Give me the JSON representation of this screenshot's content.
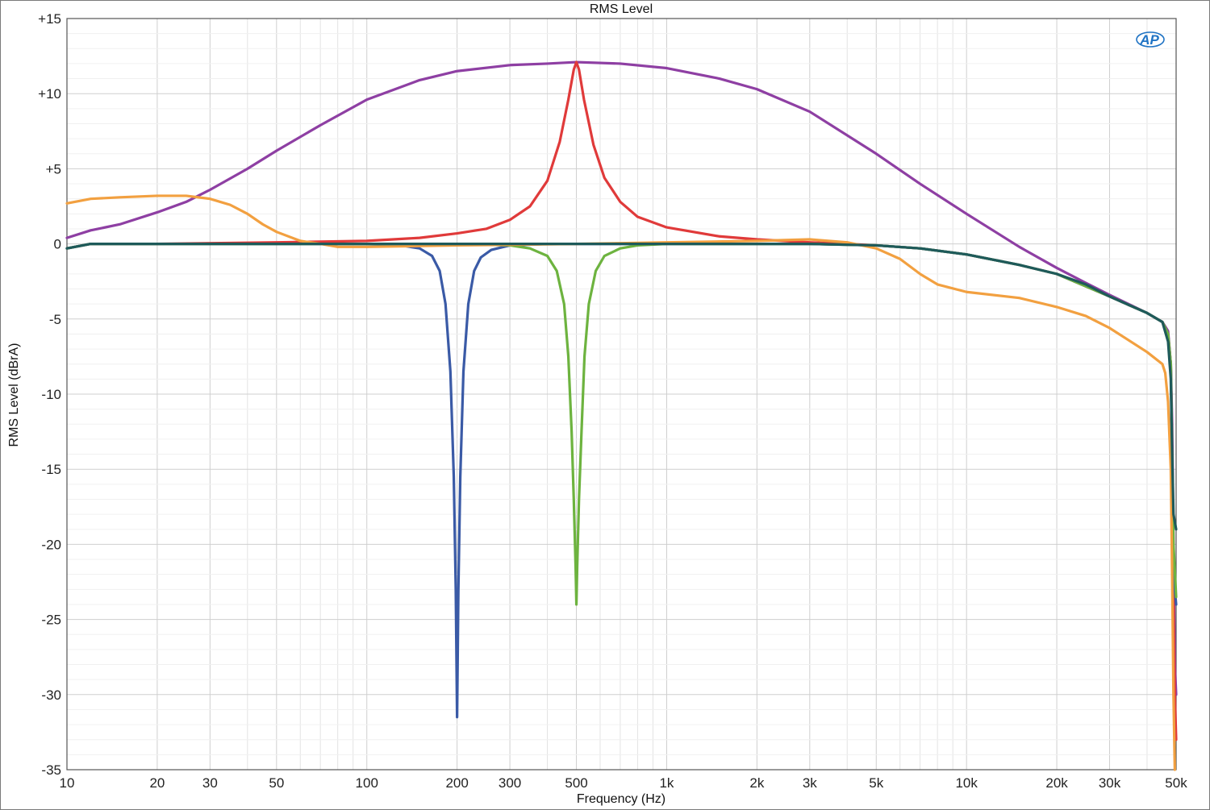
{
  "chart_data": {
    "type": "line",
    "title": "RMS Level",
    "xlabel": "Frequency (Hz)",
    "ylabel": "RMS Level (dBrA)",
    "x_scale": "log",
    "xlim": [
      10,
      50000
    ],
    "ylim": [
      -35,
      15
    ],
    "grid": true,
    "logo_text": "AP",
    "x_ticks": [
      {
        "value": 10,
        "label": "10"
      },
      {
        "value": 20,
        "label": "20"
      },
      {
        "value": 30,
        "label": "30"
      },
      {
        "value": 50,
        "label": "50"
      },
      {
        "value": 100,
        "label": "100"
      },
      {
        "value": 200,
        "label": "200"
      },
      {
        "value": 300,
        "label": "300"
      },
      {
        "value": 500,
        "label": "500"
      },
      {
        "value": 1000,
        "label": "1k"
      },
      {
        "value": 2000,
        "label": "2k"
      },
      {
        "value": 3000,
        "label": "3k"
      },
      {
        "value": 5000,
        "label": "5k"
      },
      {
        "value": 10000,
        "label": "10k"
      },
      {
        "value": 20000,
        "label": "20k"
      },
      {
        "value": 30000,
        "label": "30k"
      },
      {
        "value": 50000,
        "label": "50k"
      }
    ],
    "y_ticks": [
      {
        "value": 15,
        "label": "+15"
      },
      {
        "value": 10,
        "label": "+10"
      },
      {
        "value": 5,
        "label": "+5"
      },
      {
        "value": 0,
        "label": "0"
      },
      {
        "value": -5,
        "label": "-5"
      },
      {
        "value": -10,
        "label": "-10"
      },
      {
        "value": -15,
        "label": "-15"
      },
      {
        "value": -20,
        "label": "-20"
      },
      {
        "value": -25,
        "label": "-25"
      },
      {
        "value": -30,
        "label": "-30"
      },
      {
        "value": -35,
        "label": "-35"
      }
    ],
    "series": [
      {
        "color": "#8e3fa3",
        "points": [
          [
            10,
            0.4
          ],
          [
            12,
            0.9
          ],
          [
            15,
            1.3
          ],
          [
            20,
            2.1
          ],
          [
            25,
            2.8
          ],
          [
            30,
            3.6
          ],
          [
            40,
            5.0
          ],
          [
            50,
            6.2
          ],
          [
            70,
            7.9
          ],
          [
            100,
            9.6
          ],
          [
            150,
            10.9
          ],
          [
            200,
            11.5
          ],
          [
            300,
            11.9
          ],
          [
            400,
            12.0
          ],
          [
            500,
            12.1
          ],
          [
            700,
            12.0
          ],
          [
            1000,
            11.7
          ],
          [
            1500,
            11.0
          ],
          [
            2000,
            10.3
          ],
          [
            3000,
            8.8
          ],
          [
            5000,
            6.0
          ],
          [
            7000,
            4.0
          ],
          [
            10000,
            2.0
          ],
          [
            15000,
            -0.2
          ],
          [
            20000,
            -1.6
          ],
          [
            25000,
            -2.6
          ],
          [
            30000,
            -3.4
          ],
          [
            40000,
            -4.6
          ],
          [
            45000,
            -5.2
          ],
          [
            47000,
            -5.8
          ],
          [
            48000,
            -8.0
          ],
          [
            48500,
            -12.0
          ],
          [
            49000,
            -20.0
          ],
          [
            49500,
            -28.0
          ],
          [
            50000,
            -30.0
          ]
        ]
      },
      {
        "color": "#e03a3a",
        "points": [
          [
            10,
            -0.3
          ],
          [
            12,
            0.0
          ],
          [
            20,
            0.0
          ],
          [
            50,
            0.1
          ],
          [
            100,
            0.2
          ],
          [
            150,
            0.4
          ],
          [
            200,
            0.7
          ],
          [
            250,
            1.0
          ],
          [
            300,
            1.6
          ],
          [
            350,
            2.5
          ],
          [
            400,
            4.2
          ],
          [
            440,
            6.8
          ],
          [
            470,
            9.6
          ],
          [
            490,
            11.6
          ],
          [
            500,
            12.1
          ],
          [
            510,
            11.6
          ],
          [
            530,
            9.6
          ],
          [
            570,
            6.6
          ],
          [
            620,
            4.4
          ],
          [
            700,
            2.8
          ],
          [
            800,
            1.8
          ],
          [
            1000,
            1.1
          ],
          [
            1500,
            0.5
          ],
          [
            2000,
            0.3
          ],
          [
            3000,
            0.1
          ],
          [
            4000,
            0.0
          ],
          [
            5000,
            -0.1
          ],
          [
            7000,
            -0.3
          ],
          [
            10000,
            -0.7
          ],
          [
            15000,
            -1.4
          ],
          [
            20000,
            -2.0
          ],
          [
            30000,
            -3.5
          ],
          [
            40000,
            -4.6
          ],
          [
            45000,
            -5.2
          ],
          [
            47000,
            -6.0
          ],
          [
            48000,
            -8.0
          ],
          [
            48500,
            -14.0
          ],
          [
            49000,
            -24.0
          ],
          [
            49500,
            -30.0
          ],
          [
            50000,
            -33.0
          ]
        ]
      },
      {
        "color": "#3a5aa6",
        "points": [
          [
            10,
            -0.3
          ],
          [
            12,
            0.0
          ],
          [
            20,
            0.0
          ],
          [
            50,
            0.0
          ],
          [
            100,
            0.0
          ],
          [
            130,
            -0.1
          ],
          [
            150,
            -0.3
          ],
          [
            165,
            -0.8
          ],
          [
            175,
            -1.8
          ],
          [
            183,
            -4.0
          ],
          [
            190,
            -8.5
          ],
          [
            195,
            -15.5
          ],
          [
            198,
            -23.0
          ],
          [
            200,
            -31.5
          ],
          [
            202,
            -23.0
          ],
          [
            205,
            -15.5
          ],
          [
            210,
            -8.5
          ],
          [
            218,
            -4.0
          ],
          [
            228,
            -1.8
          ],
          [
            240,
            -0.9
          ],
          [
            260,
            -0.4
          ],
          [
            300,
            -0.1
          ],
          [
            400,
            0.0
          ],
          [
            1000,
            0.0
          ],
          [
            3000,
            0.0
          ],
          [
            5000,
            -0.1
          ],
          [
            7000,
            -0.3
          ],
          [
            10000,
            -0.7
          ],
          [
            15000,
            -1.4
          ],
          [
            20000,
            -2.0
          ],
          [
            30000,
            -3.5
          ],
          [
            40000,
            -4.6
          ],
          [
            45000,
            -5.2
          ],
          [
            47000,
            -6.0
          ],
          [
            48000,
            -8.0
          ],
          [
            48500,
            -14.0
          ],
          [
            49000,
            -22.0
          ],
          [
            50000,
            -24.0
          ]
        ]
      },
      {
        "color": "#6db33f",
        "points": [
          [
            10,
            -0.3
          ],
          [
            12,
            0.0
          ],
          [
            20,
            0.0
          ],
          [
            100,
            0.0
          ],
          [
            200,
            0.0
          ],
          [
            300,
            -0.1
          ],
          [
            350,
            -0.3
          ],
          [
            400,
            -0.8
          ],
          [
            430,
            -1.8
          ],
          [
            455,
            -4.0
          ],
          [
            470,
            -7.5
          ],
          [
            482,
            -12.5
          ],
          [
            490,
            -17.0
          ],
          [
            497,
            -21.5
          ],
          [
            500,
            -24.0
          ],
          [
            503,
            -21.5
          ],
          [
            510,
            -17.0
          ],
          [
            520,
            -12.5
          ],
          [
            532,
            -7.5
          ],
          [
            550,
            -4.0
          ],
          [
            580,
            -1.8
          ],
          [
            620,
            -0.8
          ],
          [
            700,
            -0.3
          ],
          [
            800,
            -0.1
          ],
          [
            1000,
            0.0
          ],
          [
            3000,
            0.0
          ],
          [
            5000,
            -0.1
          ],
          [
            7000,
            -0.3
          ],
          [
            10000,
            -0.7
          ],
          [
            15000,
            -1.4
          ],
          [
            20000,
            -2.0
          ],
          [
            30000,
            -3.5
          ],
          [
            40000,
            -4.6
          ],
          [
            45000,
            -5.2
          ],
          [
            47000,
            -6.0
          ],
          [
            48000,
            -8.0
          ],
          [
            48500,
            -14.0
          ],
          [
            49000,
            -20.0
          ],
          [
            50000,
            -23.5
          ]
        ]
      },
      {
        "color": "#f2a040",
        "points": [
          [
            10,
            2.7
          ],
          [
            12,
            3.0
          ],
          [
            15,
            3.1
          ],
          [
            20,
            3.2
          ],
          [
            25,
            3.2
          ],
          [
            30,
            3.0
          ],
          [
            35,
            2.6
          ],
          [
            40,
            2.0
          ],
          [
            45,
            1.3
          ],
          [
            50,
            0.8
          ],
          [
            60,
            0.2
          ],
          [
            70,
            0.0
          ],
          [
            80,
            -0.2
          ],
          [
            100,
            -0.2
          ],
          [
            200,
            -0.1
          ],
          [
            500,
            0.0
          ],
          [
            1000,
            0.1
          ],
          [
            2000,
            0.2
          ],
          [
            3000,
            0.3
          ],
          [
            4000,
            0.1
          ],
          [
            5000,
            -0.3
          ],
          [
            6000,
            -1.0
          ],
          [
            7000,
            -2.0
          ],
          [
            8000,
            -2.7
          ],
          [
            10000,
            -3.2
          ],
          [
            15000,
            -3.6
          ],
          [
            20000,
            -4.2
          ],
          [
            25000,
            -4.8
          ],
          [
            30000,
            -5.6
          ],
          [
            40000,
            -7.2
          ],
          [
            45000,
            -8.0
          ],
          [
            46000,
            -8.6
          ],
          [
            47000,
            -10.5
          ],
          [
            48000,
            -15.0
          ],
          [
            48500,
            -22.0
          ],
          [
            49000,
            -30.0
          ],
          [
            49500,
            -35.0
          ]
        ]
      },
      {
        "color": "#1e5a5a",
        "points": [
          [
            10,
            -0.3
          ],
          [
            12,
            0.0
          ],
          [
            20,
            0.0
          ],
          [
            50,
            0.0
          ],
          [
            100,
            0.0
          ],
          [
            500,
            0.0
          ],
          [
            1000,
            0.0
          ],
          [
            2000,
            0.0
          ],
          [
            3000,
            0.0
          ],
          [
            5000,
            -0.1
          ],
          [
            7000,
            -0.3
          ],
          [
            10000,
            -0.7
          ],
          [
            15000,
            -1.4
          ],
          [
            20000,
            -2.0
          ],
          [
            25000,
            -2.7
          ],
          [
            30000,
            -3.5
          ],
          [
            40000,
            -4.6
          ],
          [
            45000,
            -5.2
          ],
          [
            47000,
            -6.5
          ],
          [
            48000,
            -9.0
          ],
          [
            48500,
            -14.0
          ],
          [
            49000,
            -18.0
          ],
          [
            50000,
            -19.0
          ]
        ]
      }
    ]
  }
}
